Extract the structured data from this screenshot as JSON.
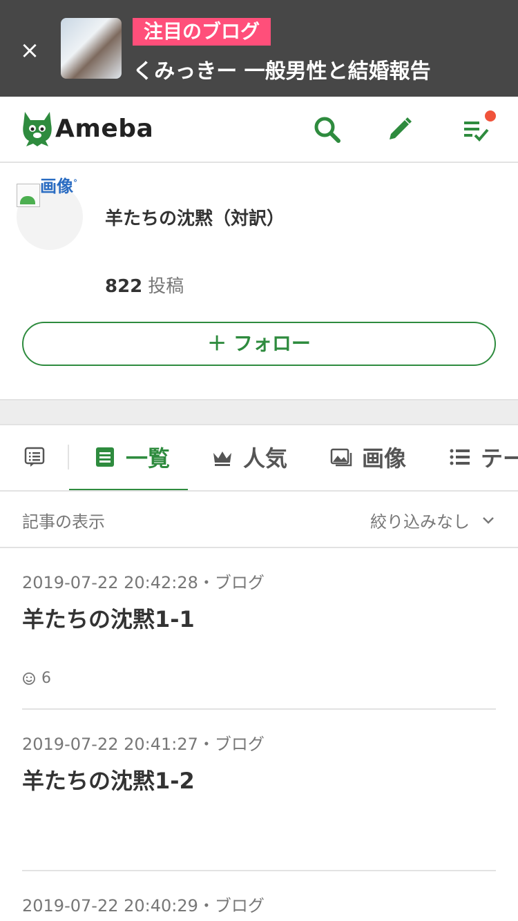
{
  "promo": {
    "badge": "注目のブログ",
    "headline": "くみっきー 一般男性と結婚報告"
  },
  "header": {
    "logo_text": "Ameba"
  },
  "profile": {
    "image_alt": "画像",
    "blog_title": "羊たちの沈黙（対訳）",
    "post_count": "822",
    "post_count_label": "投稿",
    "follow_label": "＋ フォロー"
  },
  "tabs": [
    {
      "label": "一覧",
      "active": true
    },
    {
      "label": "人気",
      "active": false
    },
    {
      "label": "画像",
      "active": false
    },
    {
      "label": "テー",
      "active": false
    }
  ],
  "filter": {
    "label": "記事の表示",
    "selected": "絞り込みなし"
  },
  "articles": [
    {
      "meta": "2019-07-22 20:42:28・ブログ",
      "title": "羊たちの沈黙1-1",
      "likes": "6"
    },
    {
      "meta": "2019-07-22 20:41:27・ブログ",
      "title": "羊たちの沈黙1-2"
    },
    {
      "meta": "2019-07-22 20:40:29・ブログ"
    }
  ],
  "colors": {
    "brand_green": "#2e8b3e",
    "promo_bg": "#474747",
    "promo_badge": "#ff4f7a",
    "notification_dot": "#f0533b"
  }
}
